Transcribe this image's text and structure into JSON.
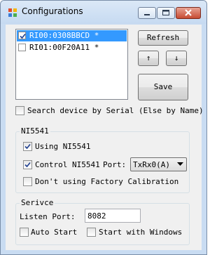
{
  "window": {
    "title": "Configurations"
  },
  "device_list": {
    "items": [
      {
        "label": "RI00:0308BBCD *",
        "checked": true,
        "selected": true
      },
      {
        "label": "RI01:00F20A11 *",
        "checked": false,
        "selected": false
      }
    ]
  },
  "buttons": {
    "refresh": "Refresh",
    "up": "↑",
    "down": "↓",
    "save": "Save"
  },
  "search_by_serial": {
    "label": "Search device by Serial (Else by Name)",
    "checked": false
  },
  "ni5541": {
    "title": "NI5541",
    "using": {
      "label": "Using NI5541",
      "checked": true
    },
    "control": {
      "label": "Control NI5541",
      "checked": true
    },
    "port_label": "Port:",
    "port_value": "TxRx0(A)",
    "factory_cal": {
      "label": "Don't using Factory Calibration",
      "checked": false
    }
  },
  "service": {
    "title": "Serivce",
    "listen_port_label": "Listen Port:",
    "listen_port_value": "8082",
    "auto_start": {
      "label": "Auto Start",
      "checked": false
    },
    "start_with_windows": {
      "label": "Start with Windows",
      "checked": false
    }
  }
}
